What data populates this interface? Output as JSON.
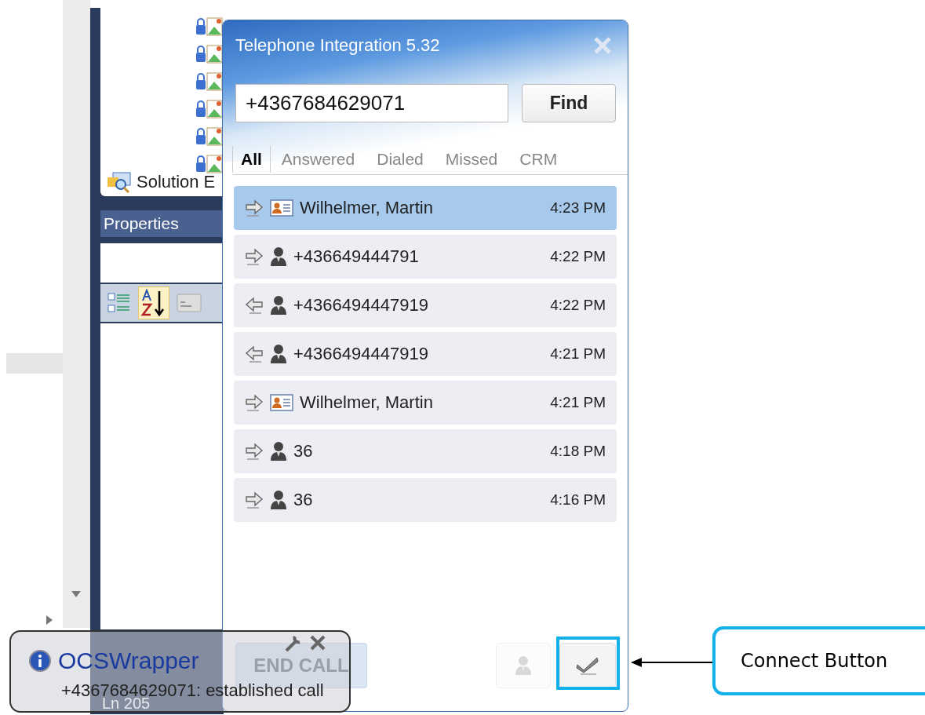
{
  "ide": {
    "solution_explorer": {
      "tab_label": "Solution E"
    },
    "properties": {
      "title": "Properties"
    },
    "status_bar": {
      "line": "Ln 205"
    }
  },
  "dialog": {
    "title": "Telephone Integration 5.32",
    "search": {
      "value": "+4367684629071"
    },
    "find_button": "Find",
    "tabs": [
      {
        "label": "All",
        "selected": true
      },
      {
        "label": "Answered",
        "selected": false
      },
      {
        "label": "Dialed",
        "selected": false
      },
      {
        "label": "Missed",
        "selected": false
      },
      {
        "label": "CRM",
        "selected": false
      }
    ],
    "calls": [
      {
        "incoming": false,
        "kind": "card",
        "name": "Wilhelmer, Martin",
        "time": "4:23 PM",
        "selected": true
      },
      {
        "incoming": false,
        "kind": "person",
        "name": "+436649444791",
        "time": "4:22 PM",
        "selected": false
      },
      {
        "incoming": true,
        "kind": "person",
        "name": "+4366494447919",
        "time": "4:22 PM",
        "selected": false
      },
      {
        "incoming": true,
        "kind": "person",
        "name": "+4366494447919",
        "time": "4:21 PM",
        "selected": false
      },
      {
        "incoming": false,
        "kind": "card",
        "name": "Wilhelmer, Martin",
        "time": "4:21 PM",
        "selected": false
      },
      {
        "incoming": false,
        "kind": "person",
        "name": "36",
        "time": "4:18 PM",
        "selected": false
      },
      {
        "incoming": false,
        "kind": "person",
        "name": "36",
        "time": "4:16 PM",
        "selected": false
      }
    ],
    "end_call_button": {
      "label": "END CALL",
      "disabled": true
    },
    "contact_button": {
      "disabled": true
    },
    "connect_button": {
      "disabled": false
    }
  },
  "notification": {
    "title": "OCSWrapper",
    "message": "+4367684629071: established call"
  },
  "annotation": {
    "label": "Connect Button"
  }
}
